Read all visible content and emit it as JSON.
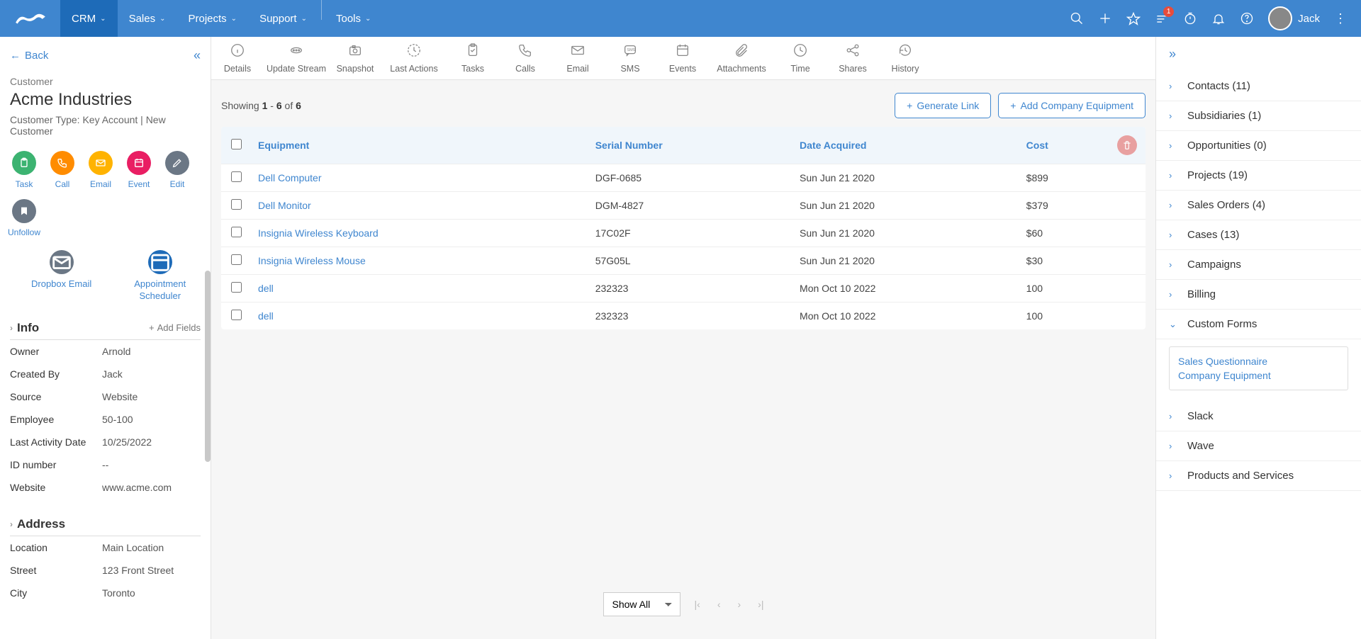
{
  "nav": {
    "items": [
      "CRM",
      "Sales",
      "Projects",
      "Support",
      "Tools"
    ],
    "active": 0
  },
  "topright": {
    "badge": "1",
    "user": "Jack"
  },
  "sidebar": {
    "back": "Back",
    "customer_label": "Customer",
    "customer_name": "Acme Industries",
    "customer_type": "Customer Type: Key Account | New Customer",
    "actions": [
      {
        "label": "Task",
        "color": "#3cb371"
      },
      {
        "label": "Call",
        "color": "#ff8c00"
      },
      {
        "label": "Email",
        "color": "#ffb300"
      },
      {
        "label": "Event",
        "color": "#e91e63"
      },
      {
        "label": "Edit",
        "color": "#6b7785"
      },
      {
        "label": "Unfollow",
        "color": "#6b7785"
      }
    ],
    "actions2": [
      {
        "label": "Dropbox Email"
      },
      {
        "label": "Appointment\nScheduler"
      }
    ],
    "info_title": "Info",
    "add_fields": "Add Fields",
    "info": [
      {
        "label": "Owner",
        "value": "Arnold"
      },
      {
        "label": "Created By",
        "value": "Jack"
      },
      {
        "label": "Source",
        "value": "Website"
      },
      {
        "label": "Employee",
        "value": "50-100"
      },
      {
        "label": "Last Activity Date",
        "value": "10/25/2022"
      },
      {
        "label": "ID number",
        "value": "--"
      },
      {
        "label": "Website",
        "value": "www.acme.com"
      }
    ],
    "address_title": "Address",
    "address": [
      {
        "label": "Location",
        "value": "Main Location"
      },
      {
        "label": "Street",
        "value": "123 Front Street"
      },
      {
        "label": "City",
        "value": "Toronto"
      }
    ]
  },
  "tabs": [
    "Details",
    "Update Stream",
    "Snapshot",
    "Last Actions",
    "Tasks",
    "Calls",
    "Email",
    "SMS",
    "Events",
    "Attachments",
    "Time",
    "Shares",
    "History"
  ],
  "toolbar": {
    "showing_prefix": "Showing ",
    "showing_from": "1",
    "showing_dash": " - ",
    "showing_to": "6",
    "showing_of": " of ",
    "showing_total": "6",
    "generate_link": "Generate Link",
    "add_equipment": "Add Company Equipment"
  },
  "table": {
    "headers": [
      "Equipment",
      "Serial Number",
      "Date Acquired",
      "Cost"
    ],
    "rows": [
      {
        "name": "Dell Computer",
        "serial": "DGF-0685",
        "date": "Sun Jun 21 2020",
        "cost": "$899"
      },
      {
        "name": "Dell Monitor",
        "serial": "DGM-4827",
        "date": "Sun Jun 21 2020",
        "cost": "$379"
      },
      {
        "name": "Insignia Wireless Keyboard",
        "serial": "17C02F",
        "date": "Sun Jun 21 2020",
        "cost": "$60"
      },
      {
        "name": "Insignia Wireless Mouse",
        "serial": "57G05L",
        "date": "Sun Jun 21 2020",
        "cost": "$30"
      },
      {
        "name": "dell",
        "serial": "232323",
        "date": "Mon Oct 10 2022",
        "cost": "100"
      },
      {
        "name": "dell",
        "serial": "232323",
        "date": "Mon Oct 10 2022",
        "cost": "100"
      }
    ]
  },
  "pager": {
    "show_all": "Show All"
  },
  "rightbar": {
    "items": [
      {
        "label": "Contacts (11)",
        "arrow": "›"
      },
      {
        "label": "Subsidiaries (1)",
        "arrow": "›"
      },
      {
        "label": "Opportunities (0)",
        "arrow": "›"
      },
      {
        "label": "Projects (19)",
        "arrow": "›"
      },
      {
        "label": "Sales Orders (4)",
        "arrow": "›"
      },
      {
        "label": "Cases (13)",
        "arrow": "›"
      },
      {
        "label": "Campaigns",
        "arrow": "›"
      },
      {
        "label": "Billing",
        "arrow": "›"
      },
      {
        "label": "Custom Forms",
        "arrow": "⌄",
        "sub": [
          "Sales Questionnaire",
          "Company Equipment"
        ]
      },
      {
        "label": "Slack",
        "arrow": "›"
      },
      {
        "label": "Wave",
        "arrow": "›"
      },
      {
        "label": "Products and Services",
        "arrow": "›"
      }
    ]
  }
}
